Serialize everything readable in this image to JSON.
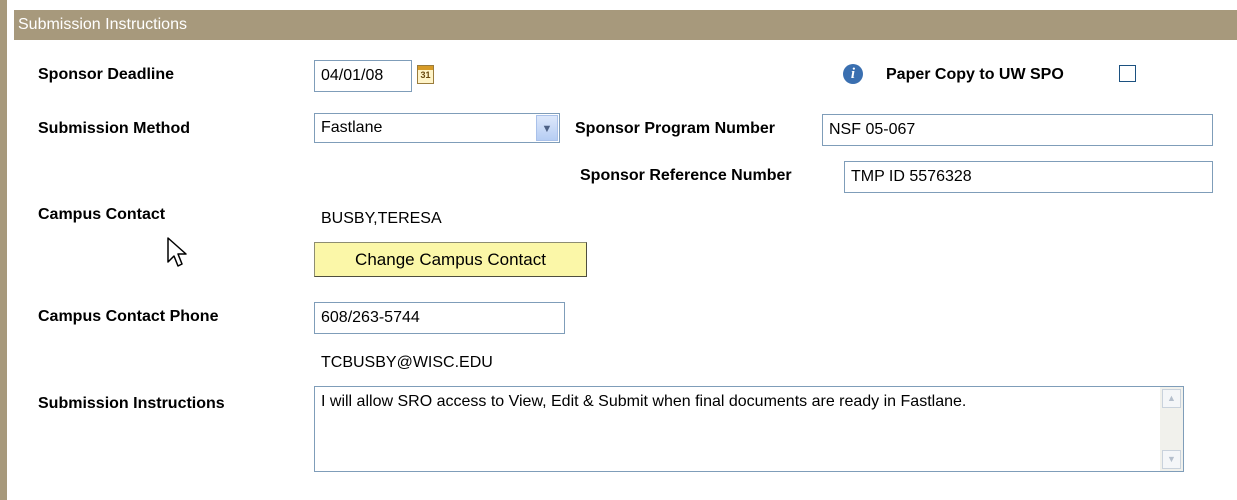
{
  "section": {
    "title": "Submission Instructions"
  },
  "fields": {
    "sponsor_deadline": {
      "label": "Sponsor Deadline",
      "value": "04/01/08",
      "icon": "calendar-icon",
      "icon_text": "31"
    },
    "paper_copy": {
      "label": "Paper Copy to UW SPO",
      "checked": false,
      "icon": "info-icon"
    },
    "submission_method": {
      "label": "Submission Method",
      "value": "Fastlane"
    },
    "sponsor_program_number": {
      "label": "Sponsor Program Number",
      "value": "NSF 05-067"
    },
    "sponsor_reference_number": {
      "label": "Sponsor Reference Number",
      "value": "TMP ID 5576328"
    },
    "campus_contact": {
      "label": "Campus Contact",
      "value": "BUSBY,TERESA",
      "button_label": "Change Campus Contact"
    },
    "campus_contact_phone": {
      "label": "Campus Contact Phone",
      "value": "608/263-5744"
    },
    "campus_contact_email": {
      "value": "TCBUSBY@WISC.EDU"
    },
    "submission_instructions": {
      "label": "Submission Instructions",
      "value": "I will allow SRO access to View, Edit & Submit when final documents are ready in Fastlane."
    }
  },
  "colors": {
    "header_bg": "#a7997c",
    "button_bg": "#fbf7a8",
    "input_border": "#7f9db9",
    "info_blue": "#3a6fb0"
  }
}
